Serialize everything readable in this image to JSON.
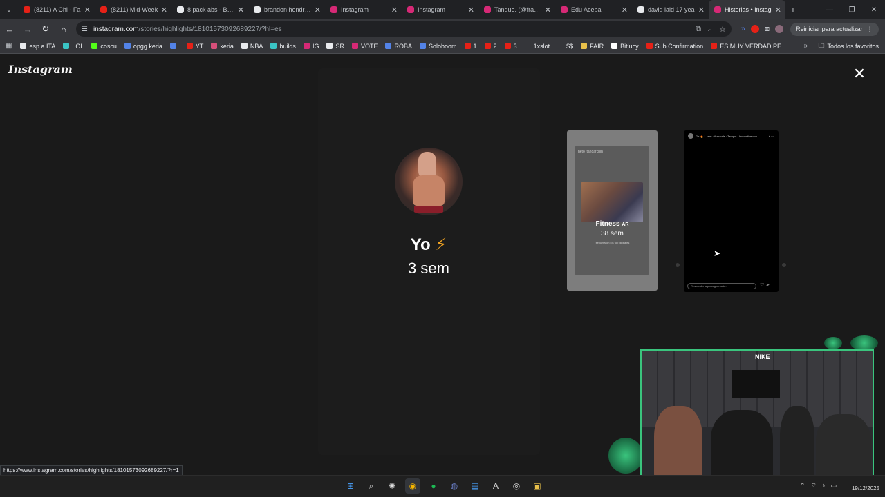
{
  "browser": {
    "tabs": [
      {
        "title": "(8211) A Chi - Fa",
        "favicon_color": "#e62117"
      },
      {
        "title": "(8211) Mid-Week",
        "favicon_color": "#e62117"
      },
      {
        "title": "8 pack abs - Busc",
        "favicon_color": "#e8eaed"
      },
      {
        "title": "brandon hendrick",
        "favicon_color": "#e8eaed"
      },
      {
        "title": "Instagram",
        "favicon_color": "#d62976"
      },
      {
        "title": "Instagram",
        "favicon_color": "#d62976"
      },
      {
        "title": "Tanque. (@franco",
        "favicon_color": "#d62976"
      },
      {
        "title": "Edu Acebal",
        "favicon_color": "#d62976"
      },
      {
        "title": "david laid 17 yea",
        "favicon_color": "#e8eaed"
      },
      {
        "title": "Historias • Instag",
        "favicon_color": "#d62976",
        "active": true
      }
    ],
    "url_host": "instagram.com",
    "url_path": "/stories/highlights/18101573092689227/?hl=es",
    "restart_label": "Reiniciar para actualizar",
    "bookmarks": [
      {
        "label": "esp a ITA",
        "color": "#e8eaed"
      },
      {
        "label": "LOL",
        "color": "#3ac4c4"
      },
      {
        "label": "coscu",
        "color": "#53fc18"
      },
      {
        "label": "opgg keria",
        "color": "#5383e8"
      },
      {
        "label": "",
        "color": "#5383e8"
      },
      {
        "label": "YT",
        "color": "#e62117"
      },
      {
        "label": "keria",
        "color": "#d64f7a"
      },
      {
        "label": "NBA",
        "color": "#e8eaed"
      },
      {
        "label": "builds",
        "color": "#3ac4c4"
      },
      {
        "label": "IG",
        "color": "#d62976"
      },
      {
        "label": "SR",
        "color": "#e8eaed"
      },
      {
        "label": "VOTE",
        "color": "#d62976"
      },
      {
        "label": "ROBA",
        "color": "#5383e8"
      },
      {
        "label": "Soloboom",
        "color": "#5383e8"
      },
      {
        "label": "1",
        "color": "#e62117"
      },
      {
        "label": "2",
        "color": "#e62117"
      },
      {
        "label": "3",
        "color": "#e62117"
      },
      {
        "label": "1xslot",
        "color": "#35363a"
      },
      {
        "label": "$$",
        "color": "#35363a"
      },
      {
        "label": "FAIR",
        "color": "#e8c04a"
      },
      {
        "label": "Bitlucy",
        "color": "#ffffff"
      },
      {
        "label": "Sub Confirmation",
        "color": "#e62117"
      },
      {
        "label": "ES MUY VERDAD PE...",
        "color": "#e62117"
      }
    ],
    "all_bookmarks_label": "Todos los favoritos",
    "status_url": "https://www.instagram.com/stories/highlights/18101573092689227/?r=1"
  },
  "instagram": {
    "logo": "Instagram",
    "highlight_name": "Yo",
    "highlight_emoji": "⚡",
    "highlight_age": "3 sem",
    "prev_highlight": {
      "title": "Fitness",
      "title_badge": "AR",
      "age": "38 sem",
      "username": "neto_tandarchin",
      "caption": "se juntaron los top globales"
    },
    "next_story": {
      "header_text": "Gir 🔥 1 sem · Armands · Tanque · Innovative.one",
      "reply_placeholder": "Responder a poca.gimnasio..."
    }
  },
  "webcam": {
    "sign_text": "NIKE"
  },
  "taskbar": {
    "clock_date": "19/12/2025",
    "apps": [
      "windows-start",
      "search",
      "chatgpt",
      "chrome",
      "spotify",
      "discord",
      "notepad",
      "autocad",
      "obs",
      "file-manager"
    ]
  }
}
